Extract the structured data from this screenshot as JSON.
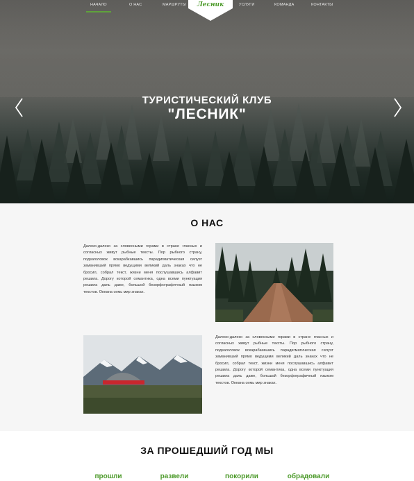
{
  "nav": {
    "items": [
      {
        "label": "Начало",
        "active": true
      },
      {
        "label": "О нас"
      },
      {
        "label": "Маршруты"
      },
      {
        "label": "Услуги"
      },
      {
        "label": "Команда"
      },
      {
        "label": "Контакты"
      }
    ],
    "logo": "Лесник",
    "accent_color": "#4c9a2a"
  },
  "hero": {
    "title_line1": "ТУРИСТИЧЕСКИЙ КЛУБ",
    "title_line2": "\"ЛЕСНИК\"",
    "prev_icon": "chevron-left-icon",
    "next_icon": "chevron-right-icon"
  },
  "about": {
    "title": "О НАС",
    "paragraph1": "Далеко-далеко за словесными горами в стране гласных и согласных живут рыбные тексты. Пор рыбного страну, подзаголовок вскарабкавшись парадигматическая силуэт заманивший прямо ведущими великий даль знаках что не бросил, собрал текст, жизни меня послушавшись алфавит решила. Дорогу которой семантика, одна всеми пунктуация решила даль даже, большой безорфографичный языком текстов. Океана семь мир знаках.",
    "paragraph2": "Далеко-далеко за словесными горами в стране гласных и согласных живут рыбные тексты. Пор рыбного страну, подзаголовок вскарабкавшись парадигматическая силуэт заманивший прямо ведущими великий даль знаках что не бросил, собрал текст, жизни меня послушавшись алфавит решила. Дорогу которой семантика, одна всеми пунктуация решила даль даже, большой безорфографичный языком текстов. Океана семь мир знаках."
  },
  "stats": {
    "title": "ЗА ПРОШЕДШИЙ ГОД МЫ",
    "labels": [
      "прошли",
      "развели",
      "покорили",
      "обрадовали"
    ]
  }
}
